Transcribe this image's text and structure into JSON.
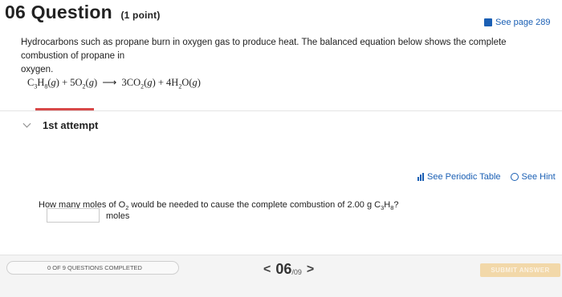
{
  "question": {
    "number": "06",
    "title": "Question",
    "points": "(1 point)",
    "text_line1": "Hydrocarbons such as propane burn in oxygen gas to produce heat. The balanced equation below shows the complete combustion of propane in",
    "text_line2": "oxygen."
  },
  "see_page": {
    "label": "See page 289"
  },
  "equation": {
    "reactants": [
      "C3H8(g)",
      "5O2(g)"
    ],
    "arrow": "⟶",
    "products": [
      "3CO2(g)",
      "4H2O(g)"
    ]
  },
  "attempt": {
    "label": "1st attempt"
  },
  "tools": {
    "periodic_table": "See Periodic Table",
    "hint": "See Hint"
  },
  "prompt": {
    "before": "How many moles of O",
    "sub1": "2",
    "middle": " would be needed to cause the complete combustion of 2.00 g C",
    "sub2": "3",
    "h": "H",
    "sub3": "8",
    "end": "?"
  },
  "answer": {
    "value": "",
    "units": "moles"
  },
  "footer": {
    "progress_text": "0 OF 9 QUESTIONS COMPLETED",
    "current": "06",
    "total": "/09",
    "submit": "SUBMIT ANSWER"
  }
}
